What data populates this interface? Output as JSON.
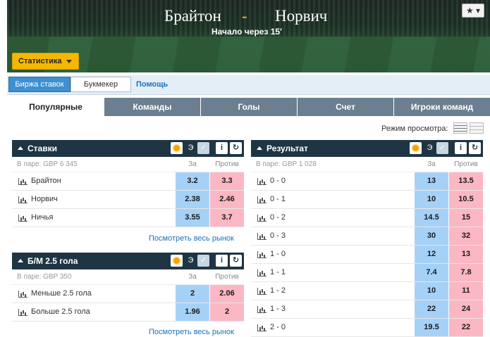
{
  "header": {
    "team_home": "Брайтон",
    "separator": "-",
    "team_away": "Норвич",
    "start_text": "Начало через 15′",
    "star_label": "★ ▾",
    "stats_button": "Статистика"
  },
  "subbar": {
    "exchange_tab": "Биржа ставок",
    "bookmaker_tab": "Букмекер",
    "help_link": "Помощь"
  },
  "main_tabs": [
    "Популярные",
    "Команды",
    "Голы",
    "Счет",
    "Игроки команд"
  ],
  "view_mode_label": "Режим просмотра:",
  "panels": {
    "bets": {
      "title": "Ставки",
      "matched": "В паре: GBP 6 345",
      "col_back": "За",
      "col_lay": "Против",
      "rows": [
        {
          "name": "Брайтон",
          "back": "3.2",
          "lay": "3.3"
        },
        {
          "name": "Норвич",
          "back": "2.38",
          "lay": "2.46"
        },
        {
          "name": "Ничья",
          "back": "3.55",
          "lay": "3.7"
        }
      ],
      "more_link": "Посмотреть весь рынок"
    },
    "overunder": {
      "title": "Б/М 2.5 гола",
      "matched": "В паре: GBP 350",
      "col_back": "За",
      "col_lay": "Против",
      "rows": [
        {
          "name": "Меньше 2.5 гола",
          "back": "2",
          "lay": "2.06"
        },
        {
          "name": "Больше 2.5 гола",
          "back": "1.96",
          "lay": "2"
        }
      ],
      "more_link": "Посмотреть весь рынок"
    },
    "result": {
      "title": "Результат",
      "matched": "В паре: GBP 1 028",
      "col_back": "За",
      "col_lay": "Против",
      "rows": [
        {
          "name": "0 - 0",
          "back": "13",
          "lay": "13.5"
        },
        {
          "name": "0 - 1",
          "back": "10",
          "lay": "10.5"
        },
        {
          "name": "0 - 2",
          "back": "14.5",
          "lay": "15"
        },
        {
          "name": "0 - 3",
          "back": "30",
          "lay": "32"
        },
        {
          "name": "1 - 0",
          "back": "12",
          "lay": "13"
        },
        {
          "name": "1 - 1",
          "back": "7.4",
          "lay": "7.8"
        },
        {
          "name": "1 - 2",
          "back": "10",
          "lay": "11"
        },
        {
          "name": "1 - 3",
          "back": "22",
          "lay": "24"
        },
        {
          "name": "2 - 0",
          "back": "19.5",
          "lay": "22"
        }
      ]
    }
  },
  "panel_icons": {
    "e_label": "Э",
    "info_label": "i",
    "refresh_label": "↻",
    "check_label": "✓"
  },
  "colors": {
    "back": "#a6d1f7",
    "lay": "#fbb7c4",
    "panel_header": "#1f3544",
    "accent": "#f5b800"
  }
}
